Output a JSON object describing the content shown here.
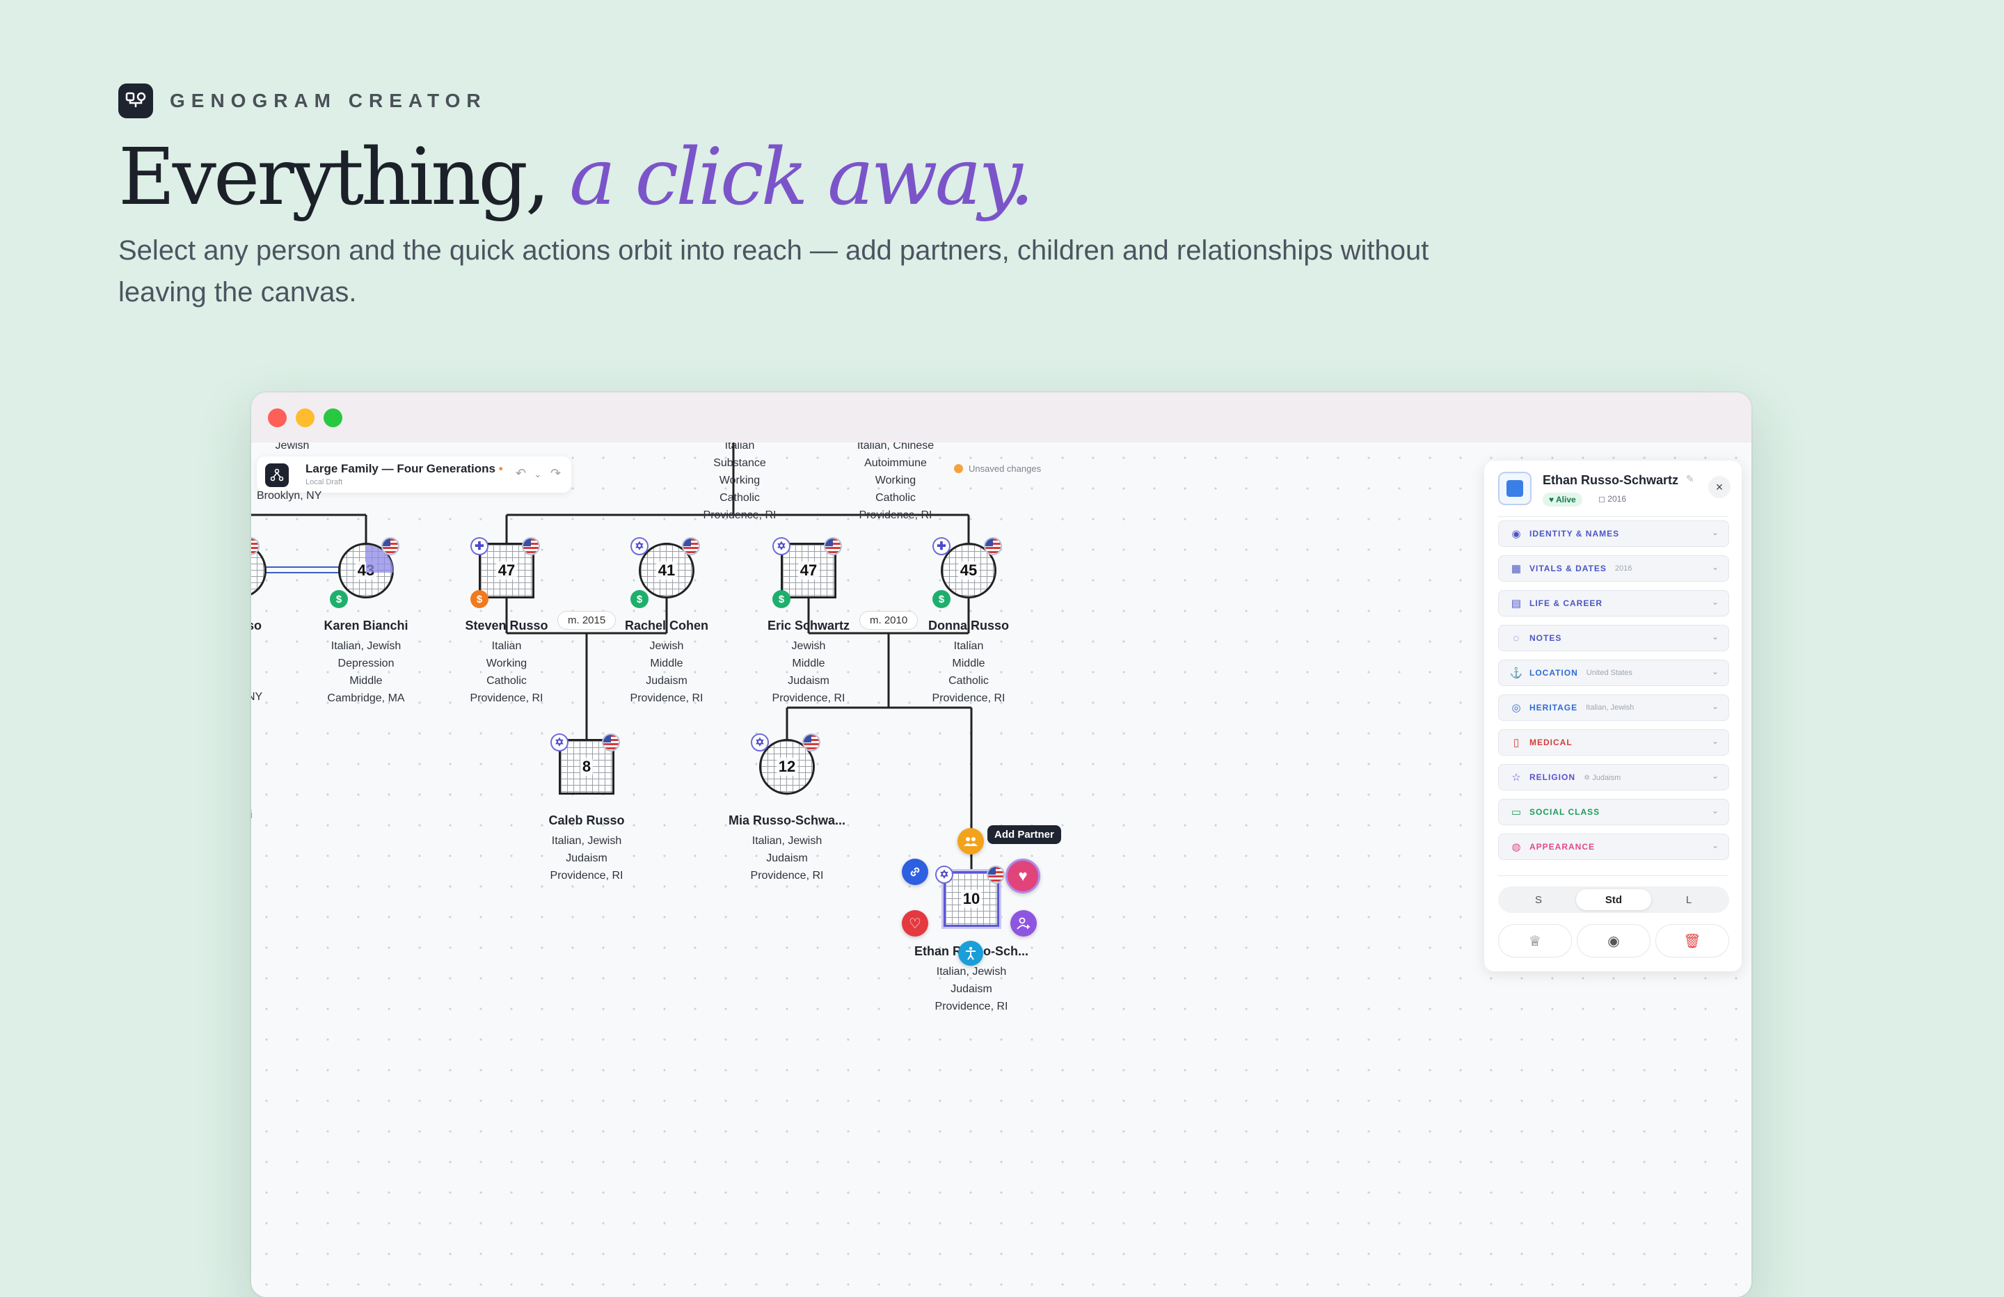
{
  "brand": {
    "name": "GENOGRAM CREATOR"
  },
  "hero": {
    "headline_plain": "Everything,",
    "headline_accent": "a click away.",
    "subhead": "Select any person and the quick actions orbit into reach — add partners, children and relationships without leaving the canvas."
  },
  "toolbar": {
    "title": "Large Family — Four Generations",
    "dirty_marker": "•",
    "subtitle": "Local Draft",
    "undo_icon": "↶",
    "menu_icon": "⌄",
    "redo_icon": "↷"
  },
  "status": {
    "unsaved": "Unsaved changes"
  },
  "partial_labels": {
    "top_left_1": "Jewish",
    "top_left_2": "Brooklyn, NY",
    "left_name": "so",
    "left_attr": "NY",
    "left_edge": "i",
    "col_a": [
      "Italian",
      "Substance",
      "Working",
      "Catholic",
      "Providence, RI"
    ],
    "col_b": [
      "Italian, Chinese",
      "Autoimmune",
      "Working",
      "Catholic",
      "Providence, RI"
    ]
  },
  "people": [
    {
      "id": "karen",
      "name": "Karen Bianchi",
      "age": "43",
      "attrs": [
        "Italian, Jewish",
        "Depression",
        "Middle",
        "Cambridge, MA"
      ],
      "badge_bl": "$"
    },
    {
      "id": "steven",
      "name": "Steven Russo",
      "age": "47",
      "attrs": [
        "Italian",
        "Working",
        "Catholic",
        "Providence, RI"
      ],
      "badge_tl": "✚",
      "badge_bl": "$"
    },
    {
      "id": "rachel",
      "name": "Rachel Cohen",
      "age": "41",
      "attrs": [
        "Jewish",
        "Middle",
        "Judaism",
        "Providence, RI"
      ],
      "badge_tl": "✡",
      "badge_bl": "$"
    },
    {
      "id": "eric",
      "name": "Eric Schwartz",
      "age": "47",
      "attrs": [
        "Jewish",
        "Middle",
        "Judaism",
        "Providence, RI"
      ],
      "badge_tl": "✡",
      "badge_bl": "$"
    },
    {
      "id": "donna",
      "name": "Donna Russo",
      "age": "45",
      "attrs": [
        "Italian",
        "Middle",
        "Catholic",
        "Providence, RI"
      ],
      "badge_tl": "✚",
      "badge_bl": "$"
    },
    {
      "id": "caleb",
      "name": "Caleb Russo",
      "age": "8",
      "attrs": [
        "Italian, Jewish",
        "Judaism",
        "Providence, RI"
      ],
      "badge_tl": "✡"
    },
    {
      "id": "mia",
      "name": "Mia Russo-Schwa...",
      "age": "12",
      "attrs": [
        "Italian, Jewish",
        "Judaism",
        "Providence, RI"
      ],
      "badge_tl": "✡"
    },
    {
      "id": "ethan",
      "name": "Ethan Russo-Sch...",
      "age": "10",
      "attrs": [
        "Italian, Jewish",
        "Judaism",
        "Providence, RI"
      ],
      "badge_tl": "✡"
    }
  ],
  "marriages": [
    {
      "label": "m. 2015"
    },
    {
      "label": "m. 2010"
    }
  ],
  "quick_actions": {
    "tooltip": "Add Partner"
  },
  "panel": {
    "name": "Ethan Russo-Schwartz",
    "alive": "♥ Alive",
    "year": "◻ 2016",
    "sections": [
      {
        "label": "IDENTITY & NAMES",
        "value": "",
        "color": "#4a55c4",
        "icon": "◉"
      },
      {
        "label": "VITALS & DATES",
        "value": "2016",
        "color": "#4a55c4",
        "icon": "▦"
      },
      {
        "label": "LIFE & CAREER",
        "value": "",
        "color": "#4a55c4",
        "icon": "▤"
      },
      {
        "label": "NOTES",
        "value": "",
        "color": "#4a55c4",
        "icon": "◌"
      },
      {
        "label": "LOCATION",
        "value": "United States",
        "color": "#2f6bd6",
        "icon": "⚓"
      },
      {
        "label": "HERITAGE",
        "value": "Italian, Jewish",
        "color": "#2f6bd6",
        "icon": "◎"
      },
      {
        "label": "MEDICAL",
        "value": "",
        "color": "#d63c3c",
        "icon": "▯"
      },
      {
        "label": "RELIGION",
        "value": "✡ Judaism",
        "color": "#5b4fd0",
        "icon": "☆"
      },
      {
        "label": "SOCIAL CLASS",
        "value": "",
        "color": "#1e9a5c",
        "icon": "▭"
      },
      {
        "label": "APPEARANCE",
        "value": "",
        "color": "#e04a8c",
        "icon": "◍"
      }
    ],
    "sizes": [
      "S",
      "Std",
      "L"
    ],
    "actions": {
      "crown": "♕",
      "eye": "◉",
      "trash": "🗑"
    }
  },
  "colors": {
    "accent": "#7b54c9",
    "select": "#5a57d6"
  }
}
